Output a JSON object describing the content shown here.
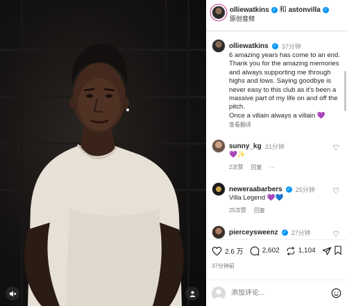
{
  "post_header": {
    "author": "olliewatkins",
    "joiner": "和",
    "coauthor": "astonvilla",
    "subtitle": "原创音频"
  },
  "caption": {
    "author": "olliewatkins",
    "time": "37分钟",
    "lines": [
      "6 amazing years has come to an end. Thank you for the amazing memories and always supporting me through highs and lows. Saying goodbye is never easy to this club as it's been a massive part of my life on and off the pitch.",
      "Once a villain always a villain 💜"
    ],
    "translate": "查看翻译"
  },
  "comments": [
    {
      "user": "sunny_kg",
      "time": "31分钟",
      "text": "💜✨",
      "likes": "2次赞",
      "reply": "回复",
      "more": "···"
    },
    {
      "user": "neweraabarbers",
      "time": "25分钟",
      "text": "Villa Legend 💜💙",
      "likes": "25次赞",
      "reply": "回复"
    },
    {
      "user": "pierceysweenz",
      "time": "27分钟",
      "text": ""
    }
  ],
  "actions": {
    "likes": "2.6 万",
    "comments": "2,602",
    "shares": "1,104",
    "posted": "37分钟前"
  },
  "composer": {
    "placeholder": "添加评论..."
  },
  "colors": {
    "verified": "#0095f6",
    "accent_purple": "#8a4fd1",
    "muted_text": "#737373"
  }
}
